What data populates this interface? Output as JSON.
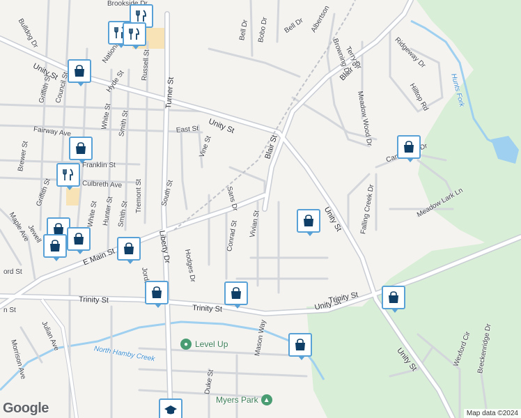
{
  "map": {
    "colors": {
      "background": "#f5f3f0",
      "park": "#d8eed6",
      "road": "#ffffff",
      "road_outline": "#c9cdd4",
      "main_road": "#ffffff",
      "water": "#9fd0f0",
      "pin_border": "#58a1d6",
      "pin_icon": "#0f3f66"
    },
    "streets": [
      {
        "name": "Unity St"
      },
      {
        "name": "Unity St"
      },
      {
        "name": "Unity St"
      },
      {
        "name": "Unity St"
      },
      {
        "name": "Unity St"
      },
      {
        "name": "Blair St"
      },
      {
        "name": "Blair St"
      },
      {
        "name": "Trinity St"
      },
      {
        "name": "Trinity St"
      },
      {
        "name": "Trinity St"
      },
      {
        "name": "E Main St"
      },
      {
        "name": "Liberty Dr"
      },
      {
        "name": "Turner St"
      },
      {
        "name": "National"
      },
      {
        "name": "Bulldog Dr"
      },
      {
        "name": "Griffith St"
      },
      {
        "name": "Council St"
      },
      {
        "name": "Hyde St"
      },
      {
        "name": "Russell St"
      },
      {
        "name": "Bell Dr"
      },
      {
        "name": "Bobo Dr"
      },
      {
        "name": "Bell Dr"
      },
      {
        "name": "Albertson"
      },
      {
        "name": "Terry Dr"
      },
      {
        "name": "Browning Dr"
      },
      {
        "name": "Ridgeway Dr"
      },
      {
        "name": "Hilltop Rd"
      },
      {
        "name": "Meadow Wood Dr"
      },
      {
        "name": "Fairway Ave"
      },
      {
        "name": "White St"
      },
      {
        "name": "Smith St"
      },
      {
        "name": "East St"
      },
      {
        "name": "Vine St"
      },
      {
        "name": "Franklin St"
      },
      {
        "name": "Brewer St"
      },
      {
        "name": "Culbreth Ave"
      },
      {
        "name": "Griffith St"
      },
      {
        "name": "Tremont St"
      },
      {
        "name": "South St"
      },
      {
        "name": "Sans Dr"
      },
      {
        "name": "Cambridge Dr"
      },
      {
        "name": "Meadow Lark Ln"
      },
      {
        "name": "Falling Creek Dr"
      },
      {
        "name": "Maple Ave"
      },
      {
        "name": "Jewell"
      },
      {
        "name": "Hunter St"
      },
      {
        "name": "Smith St"
      },
      {
        "name": "White St"
      },
      {
        "name": "Hodges Dr"
      },
      {
        "name": "Conrad St"
      },
      {
        "name": "Vivian St"
      },
      {
        "name": "Jordan"
      },
      {
        "name": "Julian Ave"
      },
      {
        "name": "Morrison Ave"
      },
      {
        "name": "Mason Way"
      },
      {
        "name": "Duke St"
      },
      {
        "name": "Wexford Cir"
      },
      {
        "name": "Breckenridge Dr"
      },
      {
        "name": "Brookside Dr"
      },
      {
        "name": "ord St"
      },
      {
        "name": "n St"
      }
    ],
    "water_labels": [
      {
        "name": "North Hamby Creek"
      },
      {
        "name": "Hunts Fork"
      }
    ],
    "places": [
      {
        "name": "Level Up",
        "icon": "place-icon"
      },
      {
        "name": "Myers Park",
        "icon": "park-icon"
      }
    ],
    "markers": [
      {
        "icon": "restaurant-icon"
      },
      {
        "icon": "restaurant-icon"
      },
      {
        "icon": "restaurant-icon"
      },
      {
        "icon": "shopping-bag-icon"
      },
      {
        "icon": "shopping-bag-icon"
      },
      {
        "icon": "restaurant-icon"
      },
      {
        "icon": "shopping-bag-icon"
      },
      {
        "icon": "shopping-bag-icon"
      },
      {
        "icon": "shopping-bag-icon"
      },
      {
        "icon": "shopping-bag-icon"
      },
      {
        "icon": "shopping-bag-icon"
      },
      {
        "icon": "shopping-bag-icon"
      },
      {
        "icon": "shopping-bag-icon"
      },
      {
        "icon": "shopping-bag-icon"
      },
      {
        "icon": "shopping-bag-icon"
      },
      {
        "icon": "shopping-bag-icon"
      },
      {
        "icon": "school-icon"
      }
    ],
    "logo": "Google",
    "attribution": "Map data ©2024"
  }
}
